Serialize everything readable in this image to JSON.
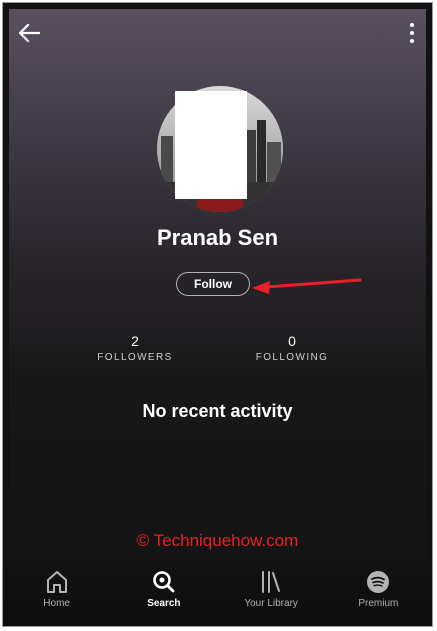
{
  "profile": {
    "name": "Pranab Sen",
    "follow_label": "Follow"
  },
  "stats": {
    "followers_count": "2",
    "followers_label": "FOLLOWERS",
    "following_count": "0",
    "following_label": "FOLLOWING"
  },
  "activity": {
    "message": "No recent activity"
  },
  "watermark": "© Techniquehow.com",
  "tabbar": {
    "active": "Search",
    "tabs": [
      {
        "label": "Home",
        "icon": "home-icon"
      },
      {
        "label": "Search",
        "icon": "search-icon"
      },
      {
        "label": "Your Library",
        "icon": "library-icon"
      },
      {
        "label": "Premium",
        "icon": "spotify-icon"
      }
    ]
  },
  "colors": {
    "background": "#121212",
    "text": "#ffffff",
    "annotation_arrow": "#e8202a",
    "watermark": "#e8202a"
  }
}
